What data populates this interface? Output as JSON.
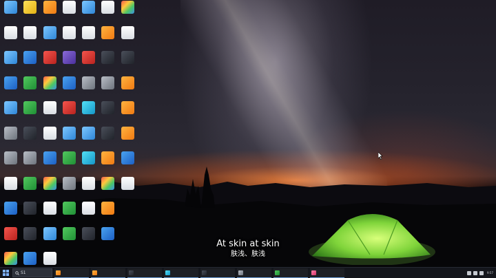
{
  "desktop": {
    "columns": [
      [
        {
          "label": "",
          "color": "g-sky",
          "name": "app-icon"
        },
        {
          "label": "",
          "color": "g-doc",
          "name": "document-icon"
        },
        {
          "label": "",
          "color": "g-sky",
          "name": "app-icon"
        },
        {
          "label": "",
          "color": "g-blue",
          "name": "app-icon"
        },
        {
          "label": "",
          "color": "g-sky",
          "name": "app-icon"
        },
        {
          "label": "",
          "color": "g-gray",
          "name": "app-icon"
        },
        {
          "label": "",
          "color": "g-gray",
          "name": "recycle-bin-icon"
        },
        {
          "label": "",
          "color": "g-doc",
          "name": "document-icon"
        },
        {
          "label": "",
          "color": "g-blue",
          "name": "app-icon"
        },
        {
          "label": "",
          "color": "g-red",
          "name": "app-icon"
        },
        {
          "label": "",
          "color": "g-multi",
          "name": "chrome-icon"
        }
      ],
      [
        {
          "label": "",
          "color": "g-yellow",
          "name": "app-icon"
        },
        {
          "label": "",
          "color": "g-doc",
          "name": "document-icon"
        },
        {
          "label": "",
          "color": "g-blue",
          "name": "app-icon"
        },
        {
          "label": "",
          "color": "g-green",
          "name": "wechat-icon"
        },
        {
          "label": "",
          "color": "g-green",
          "name": "app-icon"
        },
        {
          "label": "",
          "color": "g-dark",
          "name": "app-icon"
        },
        {
          "label": "",
          "color": "g-gray",
          "name": "app-icon"
        },
        {
          "label": "",
          "color": "g-green",
          "name": "app-icon"
        },
        {
          "label": "",
          "color": "g-dark",
          "name": "app-icon"
        },
        {
          "label": "",
          "color": "g-dark",
          "name": "app-icon"
        },
        {
          "label": "",
          "color": "g-blue",
          "name": "app-icon"
        }
      ],
      [
        {
          "label": "",
          "color": "g-orange",
          "name": "app-icon"
        },
        {
          "label": "",
          "color": "g-sky",
          "name": "app-icon"
        },
        {
          "label": "",
          "color": "g-red",
          "name": "app-icon"
        },
        {
          "label": "",
          "color": "g-multi",
          "name": "app-icon"
        },
        {
          "label": "",
          "color": "g-doc",
          "name": "document-icon"
        },
        {
          "label": "",
          "color": "g-doc",
          "name": "document-icon"
        },
        {
          "label": "",
          "color": "g-blue",
          "name": "app-icon"
        },
        {
          "label": "",
          "color": "g-multi",
          "name": "app-icon"
        },
        {
          "label": "",
          "color": "g-doc",
          "name": "document-icon"
        },
        {
          "label": "",
          "color": "g-sky",
          "name": "app-icon"
        },
        {
          "label": "",
          "color": "g-doc",
          "name": "document-icon"
        }
      ],
      [
        {
          "label": "",
          "color": "g-doc",
          "name": "document-icon"
        },
        {
          "label": "",
          "color": "g-doc",
          "name": "document-icon"
        },
        {
          "label": "",
          "color": "g-purple",
          "name": "app-icon"
        },
        {
          "label": "",
          "color": "g-blue",
          "name": "app-icon"
        },
        {
          "label": "",
          "color": "g-red",
          "name": "app-icon"
        },
        {
          "label": "",
          "color": "g-sky",
          "name": "app-icon"
        },
        {
          "label": "",
          "color": "g-green",
          "name": "app-icon"
        },
        {
          "label": "",
          "color": "g-gray",
          "name": "app-icon"
        },
        {
          "label": "",
          "color": "g-green",
          "name": "app-icon"
        },
        {
          "label": "",
          "color": "g-green",
          "name": "app-icon"
        }
      ],
      [
        {
          "label": "",
          "color": "g-sky",
          "name": "app-icon"
        },
        {
          "label": "",
          "color": "g-doc",
          "name": "document-icon"
        },
        {
          "label": "",
          "color": "g-red",
          "name": "app-icon"
        },
        {
          "label": "",
          "color": "g-gray",
          "name": "app-icon"
        },
        {
          "label": "",
          "color": "g-cyan",
          "name": "app-icon"
        },
        {
          "label": "",
          "color": "g-sky",
          "name": "app-icon"
        },
        {
          "label": "",
          "color": "g-cyan",
          "name": "edge-icon"
        },
        {
          "label": "",
          "color": "g-doc",
          "name": "document-icon"
        },
        {
          "label": "",
          "color": "g-doc",
          "name": "document-icon"
        },
        {
          "label": "",
          "color": "g-dark",
          "name": "app-icon"
        }
      ],
      [
        {
          "label": "",
          "color": "g-doc",
          "name": "document-icon"
        },
        {
          "label": "",
          "color": "g-orange",
          "name": "app-icon"
        },
        {
          "label": "",
          "color": "g-dark",
          "name": "app-icon"
        },
        {
          "label": "",
          "color": "g-gray",
          "name": "app-icon"
        },
        {
          "label": "",
          "color": "g-dark",
          "name": "app-icon"
        },
        {
          "label": "",
          "color": "g-dark",
          "name": "app-icon"
        },
        {
          "label": "",
          "color": "g-orange",
          "name": "vlc-icon"
        },
        {
          "label": "",
          "color": "g-multi",
          "name": "archive-icon"
        },
        {
          "label": "",
          "color": "g-orange",
          "name": "vlc-icon"
        },
        {
          "label": "",
          "color": "g-blue",
          "name": "virtualbox-icon"
        }
      ],
      [
        {
          "label": "",
          "color": "g-multi",
          "name": "app-icon"
        },
        {
          "label": "",
          "color": "g-doc",
          "name": "document-icon"
        },
        {
          "label": "",
          "color": "g-dark",
          "name": "game-icon"
        },
        {
          "label": "",
          "color": "g-orange",
          "name": "app-icon"
        },
        {
          "label": "",
          "color": "g-orange",
          "name": "app-icon"
        },
        {
          "label": "",
          "color": "g-orange",
          "name": "app-icon"
        },
        {
          "label": "",
          "color": "g-blue",
          "name": "app-icon"
        },
        {
          "label": "",
          "color": "g-doc",
          "name": "document-icon"
        }
      ]
    ]
  },
  "subtitle": {
    "english": "At skin at skin",
    "chinese": "肤浅、肤浅"
  },
  "taskbar": {
    "search_text": "S1",
    "tasks": [
      {
        "label": "",
        "color": "g-orange"
      },
      {
        "label": "",
        "color": "g-orange"
      },
      {
        "label": "",
        "color": "g-dark"
      },
      {
        "label": "",
        "color": "g-cyan"
      },
      {
        "label": "",
        "color": "g-dark"
      },
      {
        "label": "",
        "color": "g-gray"
      },
      {
        "label": "",
        "color": "g-green"
      },
      {
        "label": "",
        "color": "g-pink"
      }
    ],
    "weather": "",
    "weather_sub": "",
    "clock_time": "9:57",
    "clock_date": ""
  }
}
